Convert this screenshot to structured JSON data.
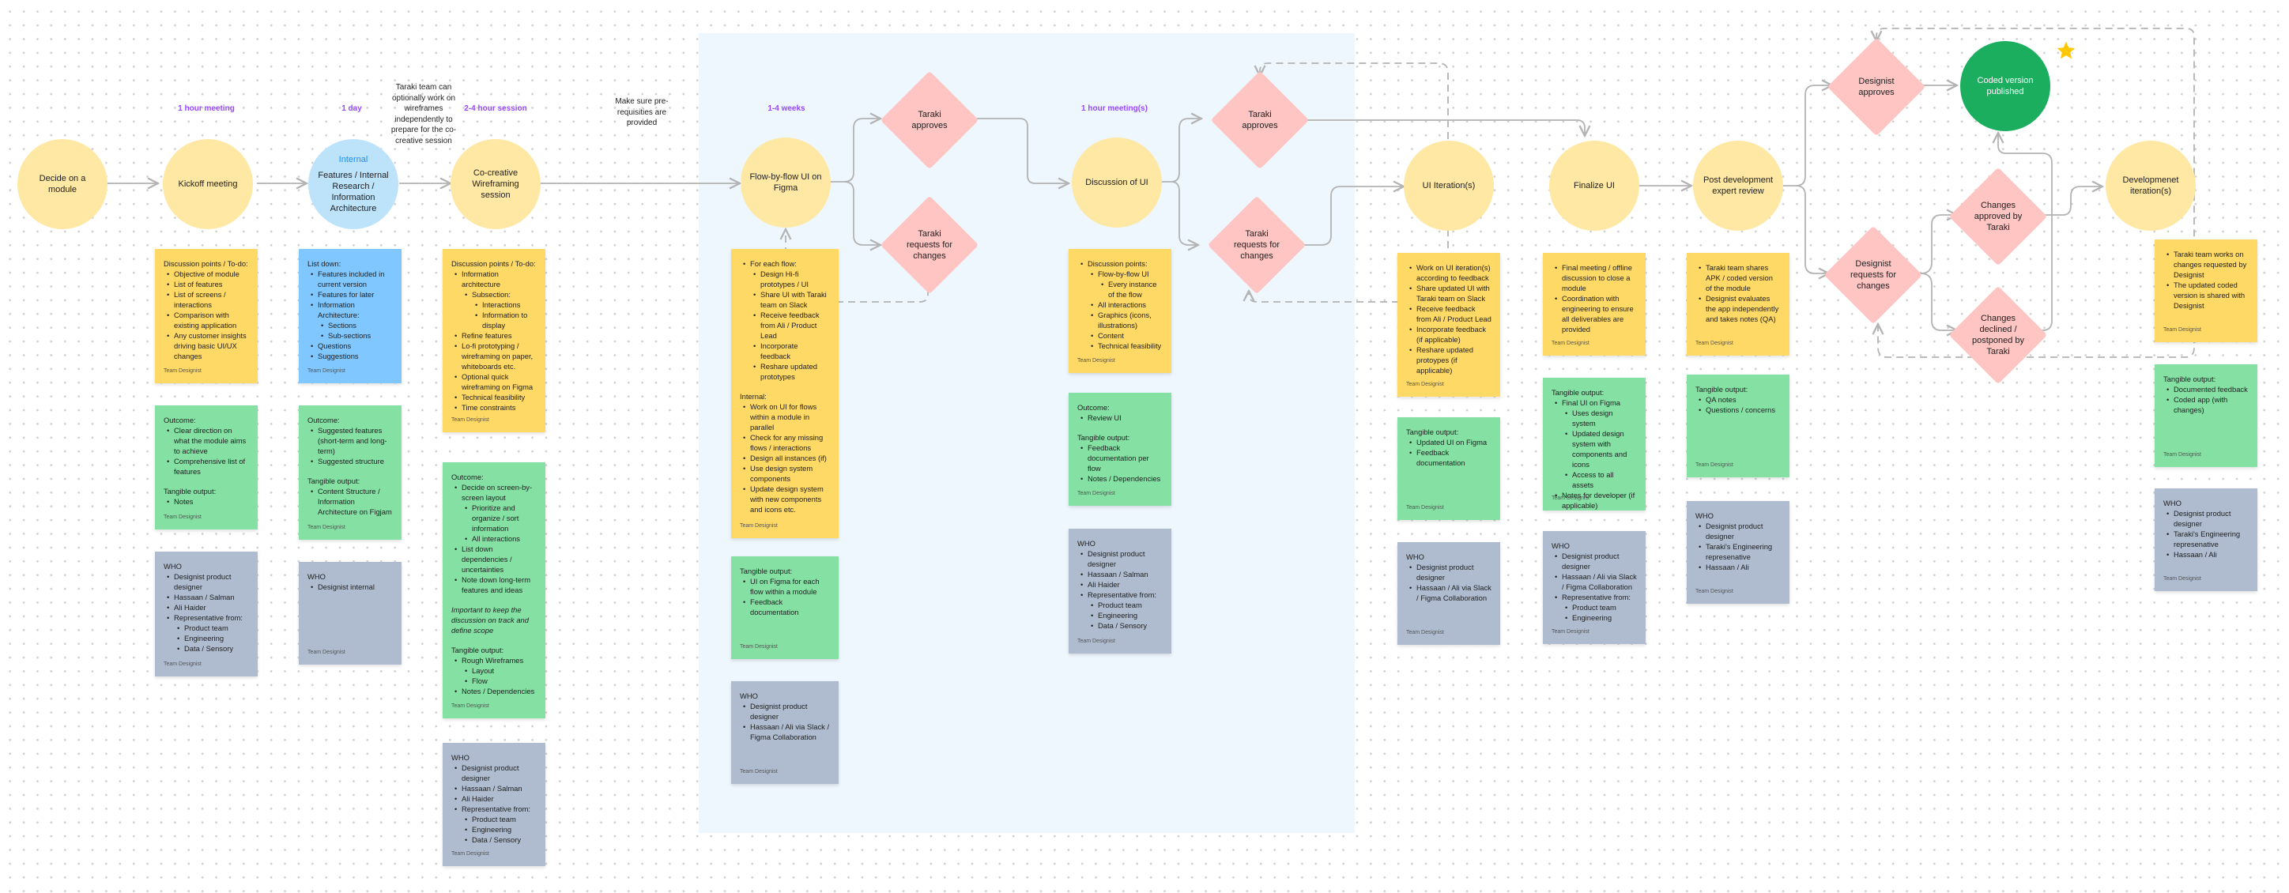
{
  "canvas": {
    "colors": {
      "background": "#ffffff",
      "section_highlight": "#eef6fe",
      "circle_yellow": "#fee8a4",
      "circle_blue": "#bde3fb",
      "circle_green": "#1bae5f",
      "diamond_pink": "#ffc5c2",
      "sticky_yellow": "#ffd966",
      "sticky_blue": "#80c7ff",
      "sticky_green": "#85e0a3",
      "sticky_gray": "#afbccf",
      "duration_purple": "#9747ff",
      "connector_gray": "#b3b3b3",
      "star_yellow": "#ffc700"
    }
  },
  "durations": {
    "kickoff": "1 hour meeting",
    "features": "1 day",
    "cocreative": "2-4 hour session",
    "flow": "1-4 weeks",
    "discussion": "1 hour meeting(s)"
  },
  "notes": {
    "taraki_optional": "Taraki team can optionally work on wireframes independently to prepare for the co-creative session",
    "prerequisites": "Make sure pre-requisities are provided"
  },
  "nodes": {
    "decide_module": "Decide on a module",
    "kickoff": "Kickoff meeting",
    "features_tag": "Internal",
    "features": "Features / Internal Research / Information Architecture",
    "cocreative": "Co-creative Wireframing session",
    "flow_ui": "Flow-by-flow UI on Figma",
    "taraki_approves_1": "Taraki approves",
    "taraki_requests_1": "Taraki requests for changes",
    "discussion_ui": "Discussion of UI",
    "taraki_approves_2": "Taraki approves",
    "taraki_requests_2": "Taraki requests for changes",
    "ui_iterations": "UI Iteration(s)",
    "finalize_ui": "Finalize UI",
    "post_dev_review": "Post development expert review",
    "designist_approves": "Designist approves",
    "designist_requests": "Designist requests for changes",
    "coded_published": "Coded version published",
    "changes_approved": "Changes approved by Taraki",
    "changes_declined": "Changes declined / postponed by Taraki",
    "dev_iterations": "Developmenet iteration(s)"
  },
  "stickies": {
    "author": "Team Designist",
    "kickoff_todo": {
      "heading": "Discussion points / To-do:",
      "items": [
        "Objective of module",
        "List of features",
        "List of screens / interactions",
        "Comparison with existing application",
        "Any customer insights driving basic UI/UX changes"
      ]
    },
    "kickoff_outcome": {
      "outcome_heading": "Outcome:",
      "outcome_items": [
        "Clear direction on what the module aims to achieve",
        "Comprehensive list of features"
      ],
      "tangible_heading": "Tangible output:",
      "tangible_items": [
        "Notes"
      ]
    },
    "kickoff_who": {
      "heading": "WHO",
      "items": [
        "Designist product designer",
        "Hassaan / Salman",
        "Ali Haider",
        "Representative from:"
      ],
      "sub_items": [
        "Product team",
        "Engineering",
        "Data / Sensory"
      ]
    },
    "features_list": {
      "heading": "List down:",
      "items": [
        "Features included in current version",
        "Features for later",
        "Information Architecture:"
      ],
      "sub_items": [
        "Sections",
        "Sub-sections"
      ],
      "items_after": [
        "Questions",
        "Suggestions"
      ]
    },
    "features_outcome": {
      "outcome_heading": "Outcome:",
      "outcome_items": [
        "Suggested features (short-term and long-term)",
        "Suggested structure"
      ],
      "tangible_heading": "Tangible output:",
      "tangible_items": [
        "Content Structure / Information Architecture on Figjam"
      ]
    },
    "features_who": {
      "heading": "WHO",
      "items": [
        "Designist internal"
      ]
    },
    "cocreative_todo": {
      "heading": "Discussion points / To-do:",
      "item_1": "Information architecture",
      "sub_1": "Subsection:",
      "subsub": [
        "Interactions",
        "Information to display"
      ],
      "items_after": [
        "Refine features",
        "Lo-fi prototyping / wireframing on paper, whiteboards etc.",
        "Optional quick wireframing on Figma",
        "Technical feasibility",
        "Time constraints"
      ]
    },
    "cocreative_outcome": {
      "outcome_heading": "Outcome:",
      "item_1": "Decide on screen-by-screen layout",
      "sub_1": [
        "Prioritize and organize / sort information",
        "All interactions"
      ],
      "items_after": [
        "List down dependencies / uncertainties",
        "Note down long-term features and ideas"
      ],
      "italic_note": "Important to keep the discussion on track and define scope",
      "tangible_heading": "Tangible output:",
      "tangible_item_1": "Rough Wireframes",
      "tangible_sub": [
        "Layout",
        "Flow"
      ],
      "tangible_after": [
        "Notes / Dependencies"
      ]
    },
    "cocreative_who": {
      "heading": "WHO",
      "items": [
        "Designist product designer",
        "Hassaan / Salman",
        "Ali Haider",
        "Representative from:"
      ],
      "sub_items": [
        "Product team",
        "Engineering",
        "Data / Sensory"
      ]
    },
    "flow_todo": {
      "item_1": "For each flow:",
      "sub_1": [
        "Design Hi-fi prototypes / UI",
        "Share UI with Taraki team on Slack",
        "Receive feedback from Ali / Product Lead",
        "Incorporate feedback",
        "Reshare updated prototypes"
      ],
      "internal_heading": "Internal:",
      "internal_items": [
        "Work on UI for flows within a module in parallel",
        "Check for any missing flows / interactions",
        "Design all instances (if)",
        "Use design system components",
        "Update design system with new components and icons etc."
      ]
    },
    "flow_tangible": {
      "heading": "Tangible output:",
      "items": [
        "UI on Figma for each flow within a module",
        "Feedback documentation"
      ]
    },
    "flow_who": {
      "heading": "WHO",
      "items": [
        "Designist product designer",
        "Hassaan / Ali via Slack / Figma Collaboration"
      ]
    },
    "discussion_todo": {
      "item_1": "Discussion points:",
      "sub_1": "Flow-by-flow UI",
      "subsub": [
        "Every instance of the flow"
      ],
      "sub_after": [
        "All interactions",
        "Graphics (icons, illustrations)",
        "Content",
        "Technical feasibility"
      ]
    },
    "discussion_outcome": {
      "outcome_heading": "Outcome:",
      "outcome_items": [
        "Review UI"
      ],
      "tangible_heading": "Tangible output:",
      "tangible_items": [
        "Feedback documentation per flow",
        "Notes / Dependencies"
      ]
    },
    "discussion_who": {
      "heading": "WHO",
      "items": [
        "Designist product designer",
        "Hassaan / Salman",
        "Ali Haider",
        "Representative from:"
      ],
      "sub_items": [
        "Product team",
        "Engineering",
        "Data / Sensory"
      ]
    },
    "iteration_todo": {
      "items": [
        "Work on UI iteration(s) according to feedback",
        "Share updated UI with Taraki team on Slack",
        "Receive feedback from Ali / Product Lead",
        "Incorporate feedback (if applicable)",
        "Reshare updated protoypes (if applicable)"
      ]
    },
    "iteration_tangible": {
      "heading": "Tangible output:",
      "items": [
        "Updated UI on Figma",
        "Feedback documentation"
      ]
    },
    "iteration_who": {
      "heading": "WHO",
      "items": [
        "Designist product designer",
        "Hassaan / Ali via Slack / Figma Collaboration"
      ]
    },
    "finalize_todo": {
      "items": [
        "Final meeting / offline discussion to close a module",
        "Coordination with engineering to ensure all deliverables are provided"
      ]
    },
    "finalize_tangible": {
      "heading": "Tangible output:",
      "item_1": "Final UI on Figma",
      "sub_1": [
        "Uses design system",
        "Updated design system with components and icons",
        "Access to all assets"
      ],
      "items_after": [
        "Notes for developer (if applicable)"
      ]
    },
    "finalize_who": {
      "heading": "WHO",
      "items": [
        "Designist product designer",
        "Hassaan / Ali via Slack / Figma Collaboration",
        "Representative from:"
      ],
      "sub_items": [
        "Product team",
        "Engineering"
      ]
    },
    "review_todo": {
      "items": [
        "Taraki team shares APK / coded version of the module",
        "Designist evaluates the app independently and takes notes (QA)"
      ]
    },
    "review_tangible": {
      "heading": "Tangible output:",
      "items": [
        "QA notes",
        "Questions / concerns"
      ]
    },
    "review_who": {
      "heading": "WHO",
      "items": [
        "Designist product designer",
        "Taraki's Engineering represenative",
        "Hassaan / Ali"
      ]
    },
    "devit_todo": {
      "items": [
        "Taraki team works on changes requested by Designist",
        "The updated coded version is shared with Designist"
      ]
    },
    "devit_tangible": {
      "heading": "Tangible output:",
      "items": [
        "Documented feedback",
        "Coded app (with changes)"
      ]
    },
    "devit_who": {
      "heading": "WHO",
      "items": [
        "Designist product designer",
        "Taraki's Engineering represenative",
        "Hassaan / Ali"
      ]
    }
  }
}
